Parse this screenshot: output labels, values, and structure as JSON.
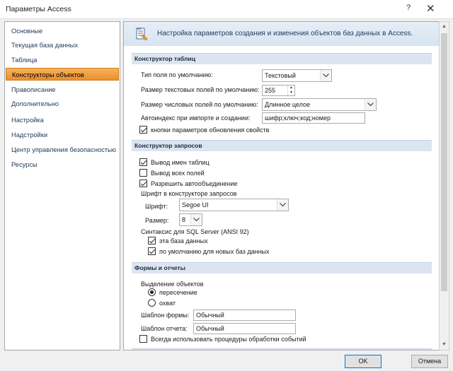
{
  "window": {
    "title": "Параметры Access",
    "help_label": "?",
    "close_label": "✕"
  },
  "sidebar": {
    "items": [
      {
        "label": "Основные"
      },
      {
        "label": "Текущая база данных"
      },
      {
        "label": "Таблица"
      },
      {
        "label": "Конструкторы объектов",
        "active": true
      },
      {
        "label": "Правописание"
      },
      {
        "label": "Дополнительно"
      },
      {
        "label": "Настройка"
      },
      {
        "label": "Надстройки"
      },
      {
        "label": "Центр управления безопасностью"
      },
      {
        "label": "Ресурсы"
      }
    ]
  },
  "header": {
    "text": "Настройка параметров создания и изменения объектов баз данных в Access.",
    "icon": "object-designer-icon"
  },
  "table_designer": {
    "title": "Конструктор таблиц",
    "field_type_label": "Тип поля по умолчанию:",
    "field_type_value": "Текстовый",
    "text_size_label": "Размер текстовых полей по умолчанию:",
    "text_size_value": "255",
    "number_size_label": "Размер числовых полей по умолчанию:",
    "number_size_value": "Длинное целое",
    "autoindex_label": "Автоиндекс при импорте и создании:",
    "autoindex_value": "шифр;ключ;код;номер",
    "property_update_label": "кнопки параметров обновления свойств",
    "property_update_checked": true
  },
  "query_designer": {
    "title": "Конструктор запросов",
    "show_table_names_label": "Вывод имен таблиц",
    "show_table_names_checked": true,
    "output_all_fields_label": "Вывод всех полей",
    "output_all_fields_checked": false,
    "autojoin_label": "Разрешить автообъединение",
    "autojoin_checked": true,
    "font_group_label": "Шрифт в конструкторе запросов",
    "font_label": "Шрифт:",
    "font_value": "Segoe UI",
    "size_label": "Размер:",
    "size_value": "8",
    "sql_syntax_label": "Синтаксис для SQL Server (ANSI 92)",
    "this_db_label": "эта база данных",
    "this_db_checked": true,
    "new_db_label": "по умолчанию для новых баз данных",
    "new_db_checked": true
  },
  "forms_reports": {
    "title": "Формы и отчеты",
    "selection_label": "Выделение объектов",
    "intersect_label": "пересечение",
    "intersect_selected": true,
    "enclose_label": "охват",
    "enclose_selected": false,
    "form_template_label": "Шаблон формы:",
    "form_template_value": "Обычный",
    "report_template_label": "Шаблон отчета:",
    "report_template_value": "Обычный",
    "event_procedures_label": "Всегда использовать процедуры обработки событий",
    "event_procedures_checked": false
  },
  "footer": {
    "ok_label": "OK",
    "cancel_label": "Отмена"
  }
}
